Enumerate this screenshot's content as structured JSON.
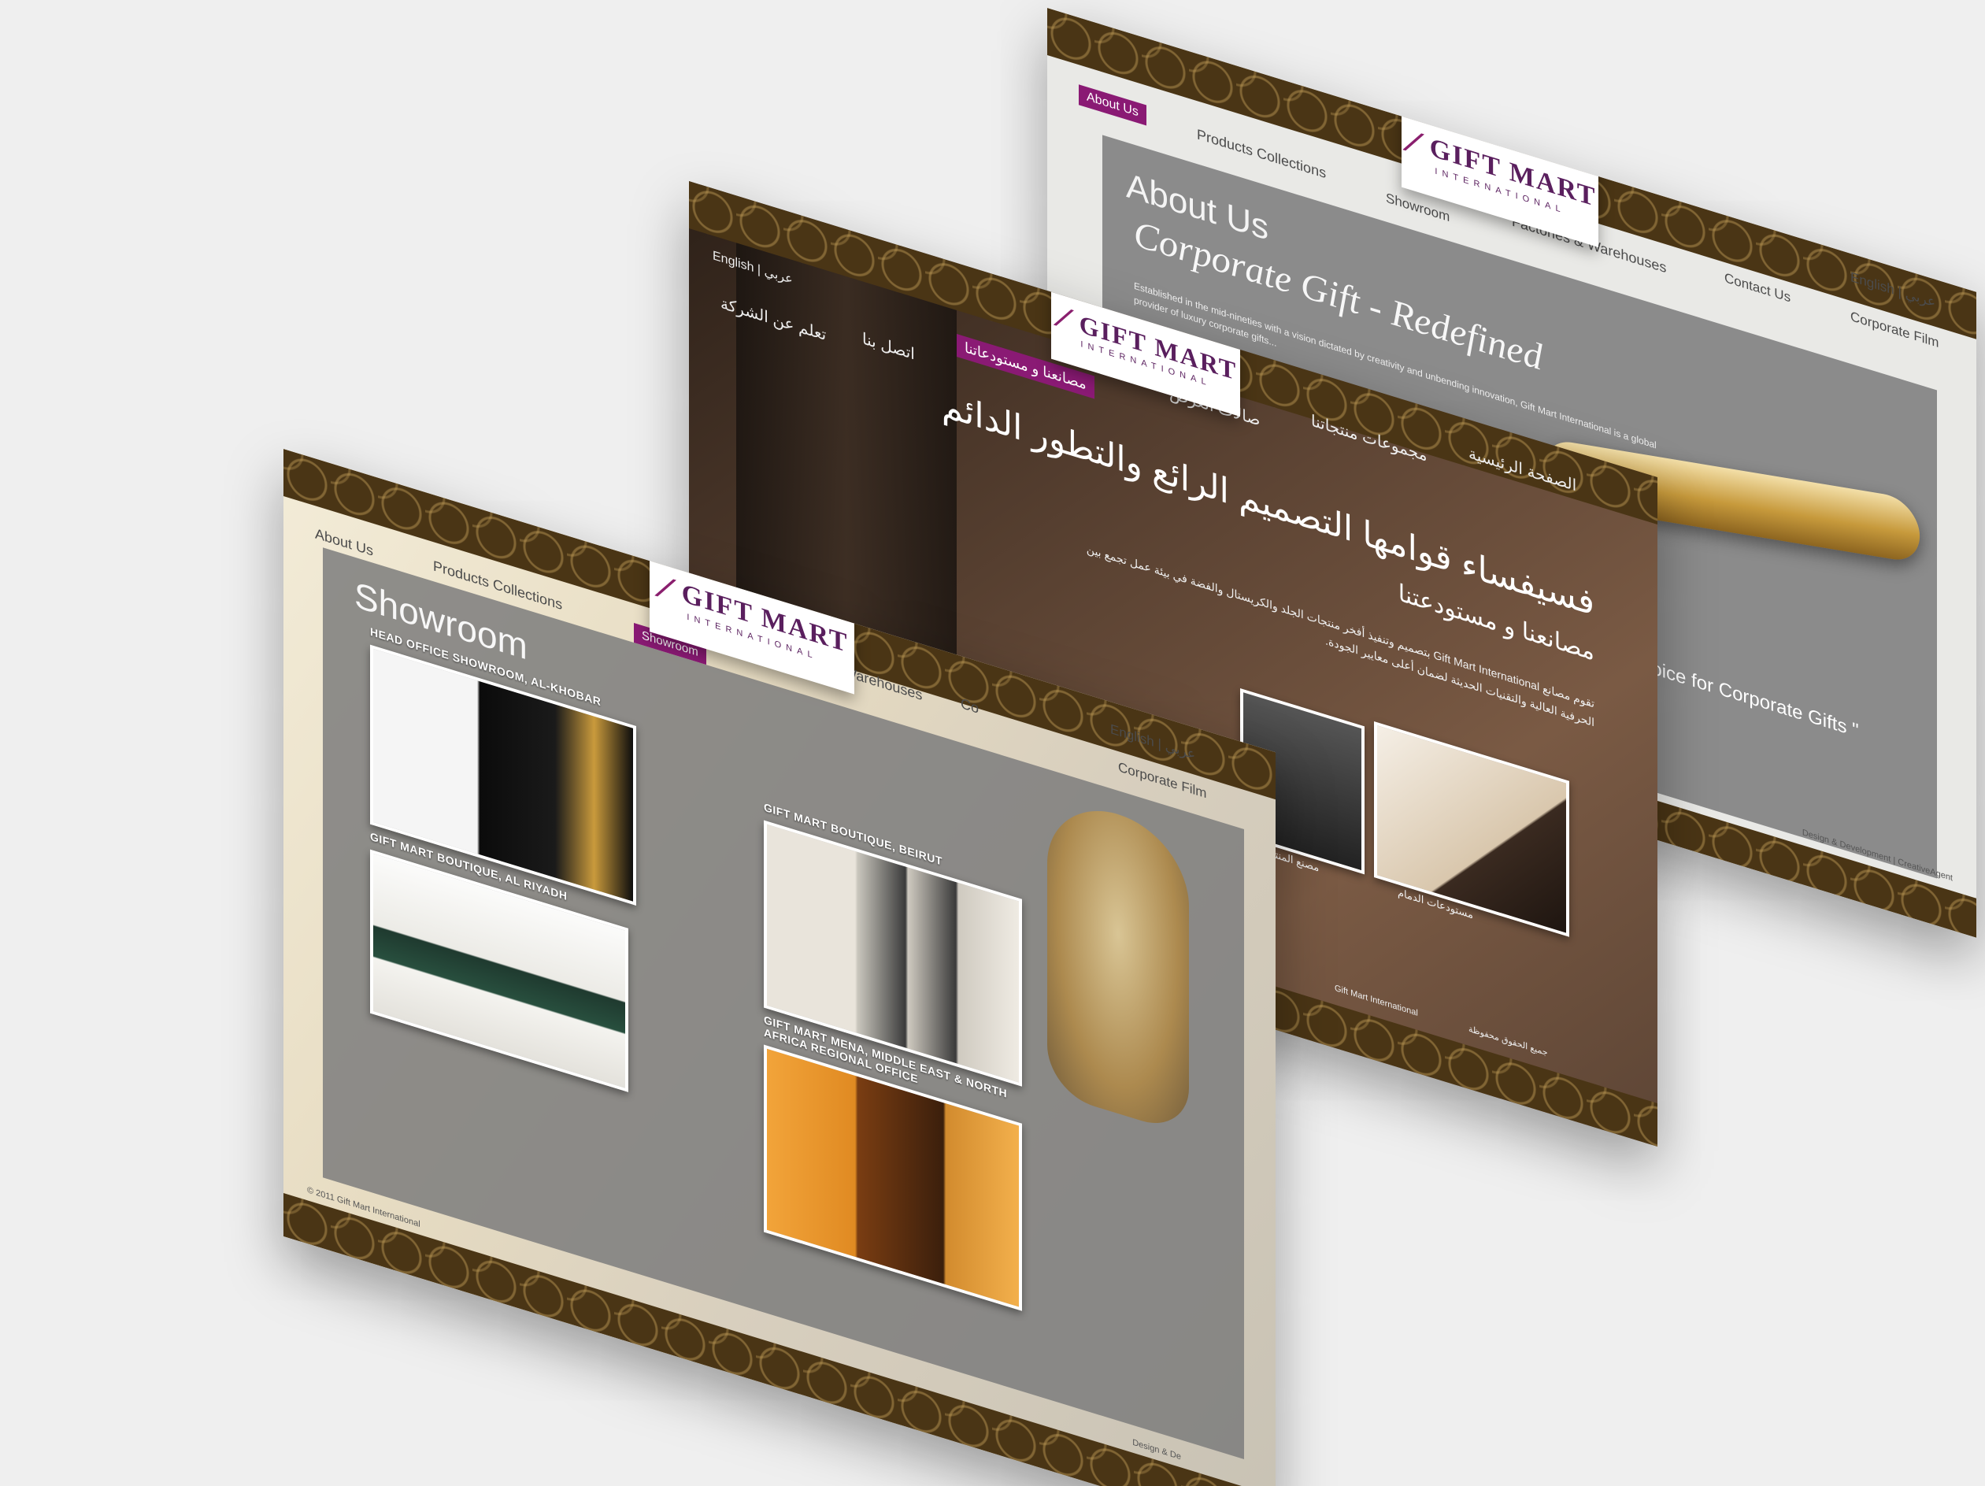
{
  "back_panel": {
    "logo": {
      "mark": "GIFT MART",
      "sub": "INTERNATIONAL"
    },
    "nav": {
      "about": "About Us",
      "products": "Products Collections",
      "showroom": "Showroom",
      "factories": "Factories & Warehouses",
      "contact": "Contact Us",
      "lang": "English | عربي",
      "film": "Corporate Film"
    },
    "heading": "About Us",
    "tagline": "Corporate Gift - Redefined",
    "body": "Established in the mid-nineties with a vision dictated by creativity and unbending innovation, Gift Mart International is a global provider of luxury corporate gifts...",
    "slogan": "of Choice for Corporate Gifts \"",
    "footer": "Design & Development | CreativeAgent",
    "colors": {
      "accent": "#8a1a74",
      "band": "#4a3515"
    }
  },
  "middle_panel": {
    "lang": "English | عربي",
    "nav": {
      "about": "تعلم عن الشركة",
      "contact": "اتصل بنا",
      "factories_active": "مصانعنا و مستودعاتنا",
      "showroom": "صالات العرض",
      "products": "مجموعات منتجاتنا",
      "home": "الصفحة الرئيسية"
    },
    "headline": "فسيفساء قوامها التصميم الرائع والتطور الدائم",
    "subheading": "مصانعنا و مستودعتنا",
    "body": "تقوم مصانع Gift Mart International بتصميم وتنفيذ أفخر منتجات الجلد والكريستال والفضة في بيئة عمل تجمع بين الحرفية العالية والتقنيات الحديثة لضمان أعلى معايير الجودة.",
    "caption_1": "مصنع المنتجات",
    "caption_2": "مستودعات الدمام",
    "footer_1": "Gift Mart International",
    "footer_2": "جميع الحقوق محفوظة"
  },
  "front_panel": {
    "logo": {
      "mark": "GIFT MART",
      "sub": "INTERNATIONAL"
    },
    "nav": {
      "about": "About Us",
      "products": "Products Collections",
      "showroom_active": "Showroom",
      "factories": "Factories & Warehouses",
      "contact": "Co",
      "lang": "English | عربي",
      "film": "Corporate Film"
    },
    "heading": "Showroom",
    "labels": {
      "head_office": "HEAD OFFICE SHOWROOM, AL-KHOBAR",
      "riyadh": "GIFT MART BOUTIQUE, AL RIYADH",
      "beirut": "GIFT MART BOUTIQUE, BEIRUT",
      "mena": "GIFT MART MENA, MIDDLE EAST & NORTH AFRICA REGIONAL OFFICE"
    },
    "footer_left": "© 2011 Gift Mart International",
    "footer_right": "Design & De"
  }
}
